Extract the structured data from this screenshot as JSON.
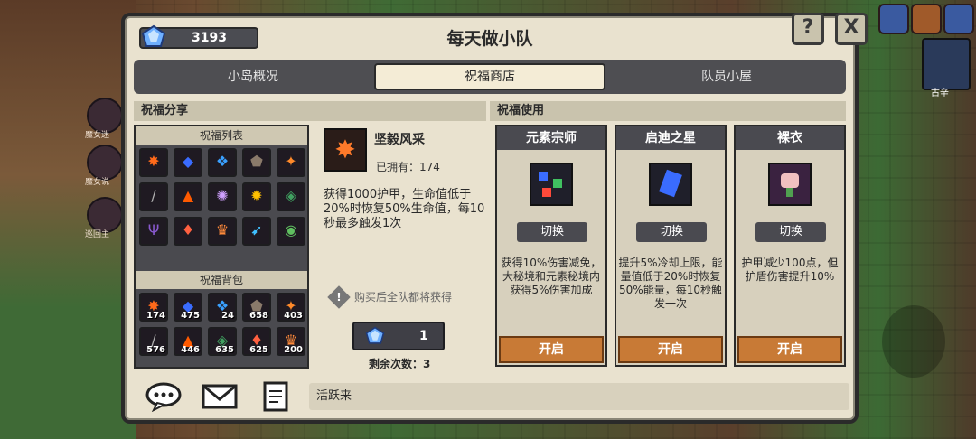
{
  "window": {
    "title": "每天做小队",
    "currency_value": "3193",
    "help_label": "?",
    "close_label": "X"
  },
  "tabs": [
    {
      "label": "小岛概况"
    },
    {
      "label": "祝福商店"
    },
    {
      "label": "队员小屋"
    }
  ],
  "left_section": {
    "title": "祝福分享",
    "list_title": "祝福列表",
    "bag_title": "祝福背包"
  },
  "blessing_list": [
    {
      "icon": "burst-icon",
      "color": "#ff6a1a",
      "glyph": "✸"
    },
    {
      "icon": "crystal-icon",
      "color": "#3a6cff",
      "glyph": "◆"
    },
    {
      "icon": "orb-icon",
      "color": "#3aa0ff",
      "glyph": "❖"
    },
    {
      "icon": "shield-icon",
      "color": "#8a7a6a",
      "glyph": "⬟"
    },
    {
      "icon": "star-icon",
      "color": "#ff8a2a",
      "glyph": "✦"
    },
    {
      "icon": "sword-icon",
      "color": "#b0b0b0",
      "glyph": "/"
    },
    {
      "icon": "fire-icon",
      "color": "#ff5a00",
      "glyph": "▲"
    },
    {
      "icon": "nova-icon",
      "color": "#d0a0ff",
      "glyph": "✺"
    },
    {
      "icon": "sun-icon",
      "color": "#ffc000",
      "glyph": "✹"
    },
    {
      "icon": "gems-icon",
      "color": "#40a060",
      "glyph": "◈"
    },
    {
      "icon": "goblet-icon",
      "color": "#8a5ad0",
      "glyph": "Ψ"
    },
    {
      "icon": "leaf-icon",
      "color": "#ff6040",
      "glyph": "♦"
    },
    {
      "icon": "crown-icon",
      "color": "#ff8a3a",
      "glyph": "♛"
    },
    {
      "icon": "wings-icon",
      "color": "#40c0ff",
      "glyph": "➹"
    },
    {
      "icon": "ring-icon",
      "color": "#60c060",
      "glyph": "◉"
    },
    {
      "icon": "slime-icon",
      "color": "#40c0a0",
      "glyph": "●"
    },
    {
      "icon": "cloud-icon",
      "color": "#a0a0ff",
      "glyph": "☁"
    }
  ],
  "blessing_bag": [
    {
      "icon": "burst-icon",
      "color": "#ff6a1a",
      "glyph": "✸",
      "count": "174"
    },
    {
      "icon": "crystal-icon",
      "color": "#3a6cff",
      "glyph": "◆",
      "count": "475"
    },
    {
      "icon": "orb-icon",
      "color": "#3aa0ff",
      "glyph": "❖",
      "count": "24"
    },
    {
      "icon": "shield-icon",
      "color": "#8a7a6a",
      "glyph": "⬟",
      "count": "658"
    },
    {
      "icon": "star-icon",
      "color": "#ff8a2a",
      "glyph": "✦",
      "count": "403"
    },
    {
      "icon": "sword-icon",
      "color": "#b0b0b0",
      "glyph": "/",
      "count": "576"
    },
    {
      "icon": "fire-icon",
      "color": "#ff5a00",
      "glyph": "▲",
      "count": "446"
    },
    {
      "icon": "gems-icon",
      "color": "#40a060",
      "glyph": "◈",
      "count": "635"
    },
    {
      "icon": "leaf-icon",
      "color": "#ff6040",
      "glyph": "♦",
      "count": "625"
    },
    {
      "icon": "crown-icon",
      "color": "#ff8a3a",
      "glyph": "♛",
      "count": "200"
    }
  ],
  "detail": {
    "name": "坚毅风采",
    "owned": "已拥有：174",
    "desc": "获得1000护甲，生命值低于20%时恢复50%生命值，每10秒最多触发1次",
    "note": "购买后全队都将获得",
    "price": "1",
    "remaining": "剩余次数：3"
  },
  "right_section": {
    "title": "祝福使用"
  },
  "cards": [
    {
      "name": "元素宗师",
      "icon": "elements-icon",
      "switch": "切换",
      "desc": "获得10%伤害减免，大秘境和元素秘境内获得5%伤害加成",
      "open": "开启"
    },
    {
      "name": "启迪之星",
      "icon": "star-crystal-icon",
      "switch": "切换",
      "desc": "提升5%冷却上限，能量值低于20%时恢复50%能量，每10秒触发一次",
      "open": "开启"
    },
    {
      "name": "裸衣",
      "icon": "robe-icon",
      "switch": "切换",
      "desc": "护甲减少100点，但护盾伤害提升10%",
      "open": "开启"
    }
  ],
  "bottom": {
    "chat_text": "活跃来"
  },
  "hud": {
    "player_name": "古辛",
    "left_labels": [
      "魔女迷",
      "魔女说",
      "巡回主"
    ]
  },
  "colors": {
    "accent_orange": "#c87a36",
    "panel_dark": "#4a4a50",
    "panel_light": "#e9e2cf"
  }
}
